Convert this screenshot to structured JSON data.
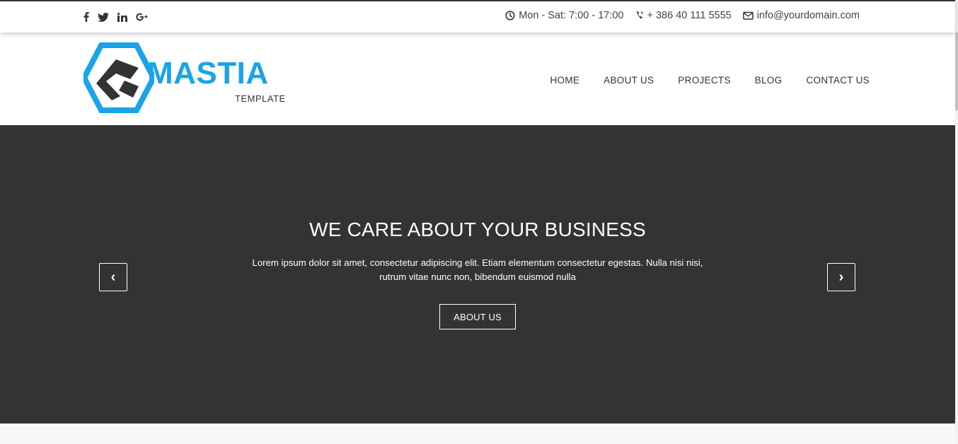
{
  "topbar": {
    "social": [
      "facebook-icon",
      "twitter-icon",
      "linkedin-icon",
      "google-plus-icon"
    ],
    "hours": "Mon - Sat: 7:00 - 17:00",
    "phone": "+ 386 40 111 5555",
    "email": "info@yourdomain.com"
  },
  "brand": {
    "name": "MASTIA",
    "sub": "TEMPLATE",
    "color": "#1aa3e8",
    "dark": "#333333"
  },
  "nav": {
    "items": [
      "HOME",
      "ABOUT US",
      "PROJECTS",
      "BLOG",
      "CONTACT US"
    ]
  },
  "hero": {
    "title": "WE CARE ABOUT YOUR BUSINESS",
    "text": "Lorem ipsum dolor sit amet, consectetur adipiscing elit. Etiam elementum consectetur egestas. Nulla nisi nisi, rutrum vitae nunc non, bibendum euismod nulla",
    "button": "ABOUT US",
    "prev": "‹",
    "next": "›",
    "background": "#333333"
  }
}
